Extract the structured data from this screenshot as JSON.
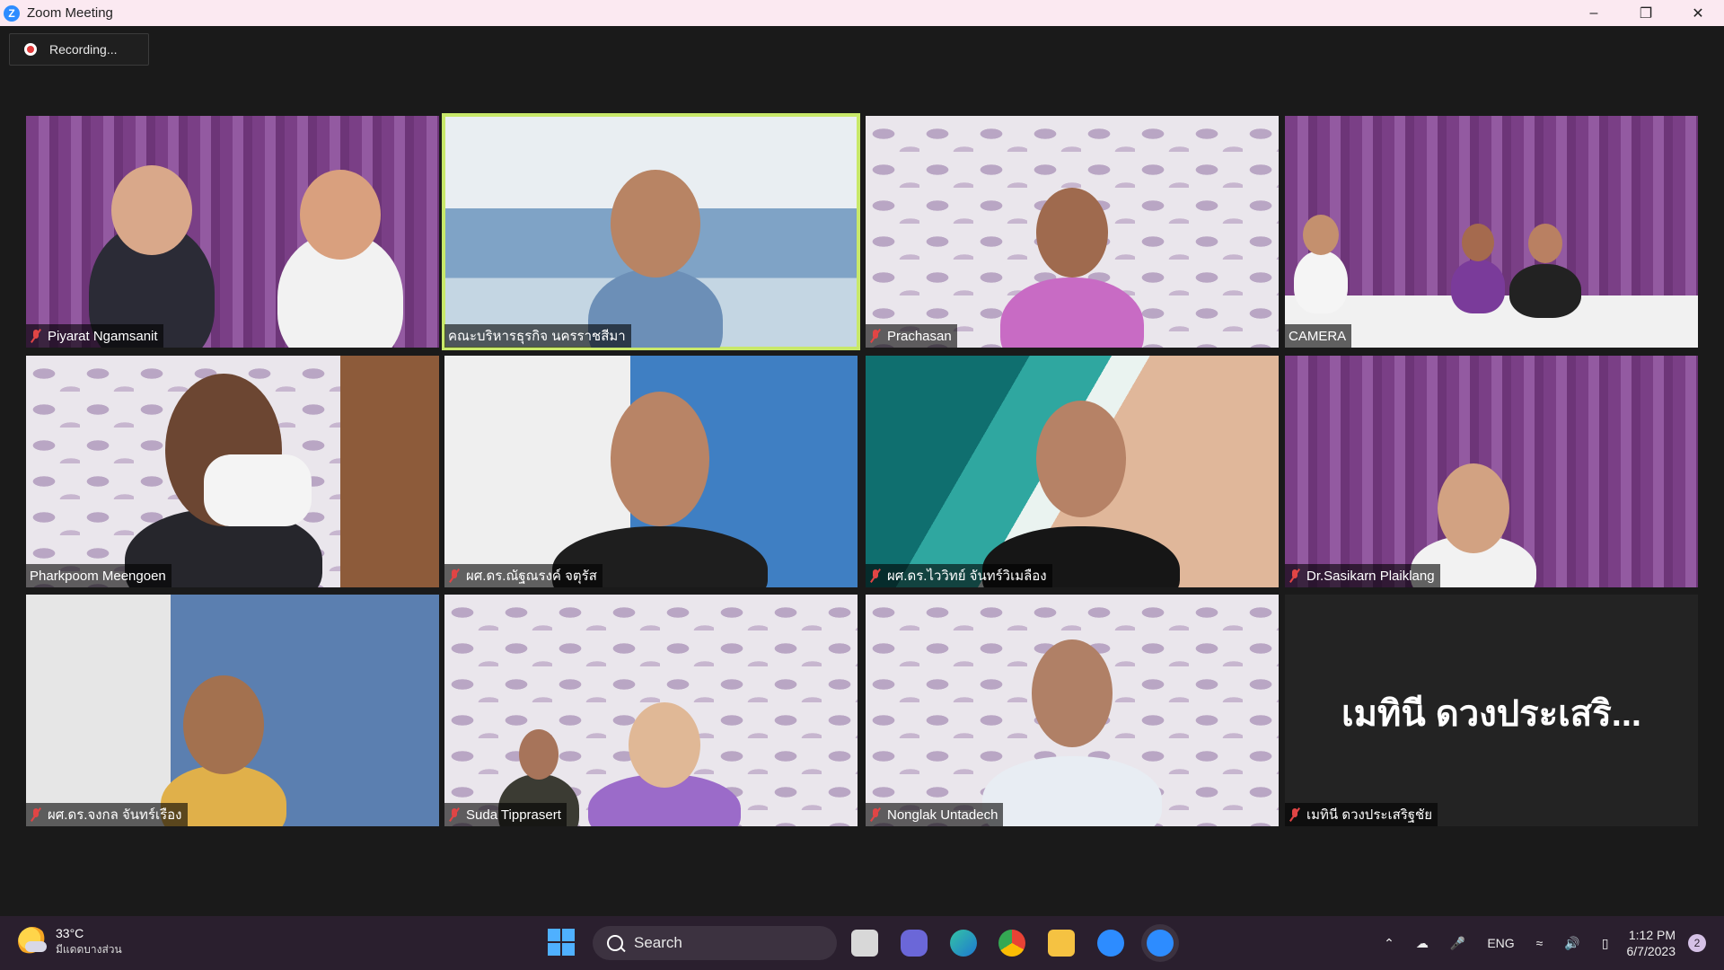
{
  "window": {
    "title": "Zoom Meeting"
  },
  "recording": {
    "label": "Recording..."
  },
  "participants": [
    {
      "name": "Piyarat Ngamsanit",
      "muted": true
    },
    {
      "name": "คณะบริหารธุรกิจ นครราชสีมา",
      "muted": false,
      "active_speaker": true
    },
    {
      "name": "Prachasan",
      "muted": true
    },
    {
      "name": "CAMERA",
      "muted": false
    },
    {
      "name": "Pharkpoom Meengoen",
      "muted": false
    },
    {
      "name": "ผศ.ดร.ณัฐณรงค์ จตุรัส",
      "muted": true
    },
    {
      "name": "ผศ.ดร.ไววิทย์ จันทร์วิเมลือง",
      "muted": true
    },
    {
      "name": "Dr.Sasikarn Plaiklang",
      "muted": true
    },
    {
      "name": "ผศ.ดร.จงกล จันทร์เรือง",
      "muted": true
    },
    {
      "name": "Suda Tipprasert",
      "muted": true
    },
    {
      "name": "Nonglak Untadech",
      "muted": true
    },
    {
      "name": "เมทินี ดวงประเสริฐชัย",
      "muted": true,
      "video_off_label": "เมทินี ดวงประเสริ..."
    }
  ],
  "taskbar": {
    "weather": {
      "temp": "33°C",
      "condition": "มีแดดบางส่วน"
    },
    "search_label": "Search",
    "language": "ENG",
    "time": "1:12 PM",
    "date": "6/7/2023",
    "notification_count": "2"
  },
  "colors": {
    "active_speaker_border": "#c8e86a",
    "muted_icon": "#e04545",
    "zoom_blue": "#2d8cff"
  }
}
